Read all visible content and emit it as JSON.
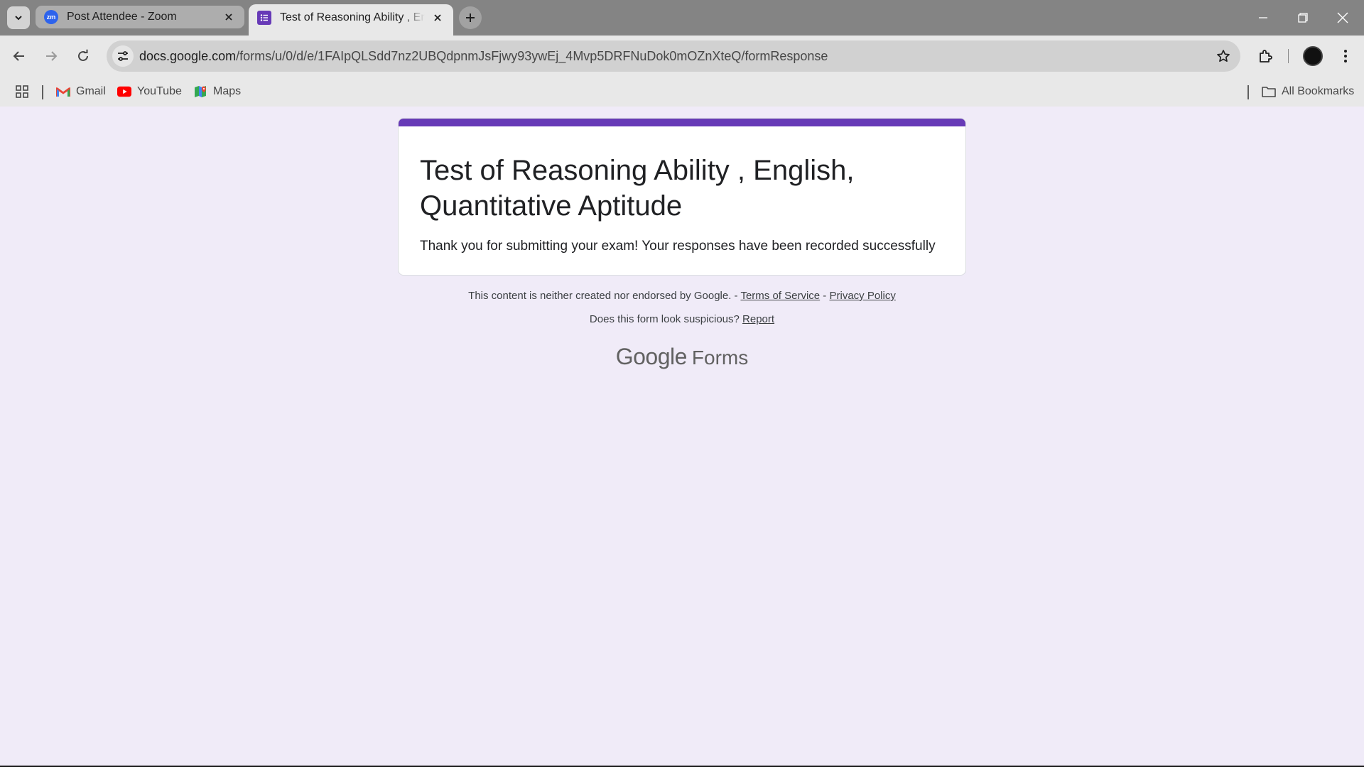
{
  "browser": {
    "tabs": [
      {
        "title": "Post Attendee - Zoom",
        "favicon_text": "zm",
        "active": false
      },
      {
        "title": "Test of Reasoning Ability , English, Quantitative Aptitude",
        "active": true
      }
    ],
    "url_host": "docs.google.com",
    "url_path": "/forms/u/0/d/e/1FAIpQLSdd7nz2UBQdpnmJsFjwy93ywEj_4Mvp5DRFNuDok0mOZnXteQ/formResponse",
    "bookmarks": [
      {
        "label": "Gmail",
        "icon": "gmail-icon"
      },
      {
        "label": "YouTube",
        "icon": "youtube-icon"
      },
      {
        "label": "Maps",
        "icon": "maps-icon"
      }
    ],
    "all_bookmarks_label": "All Bookmarks"
  },
  "form": {
    "title": "Test of Reasoning Ability , English, Quantitative Aptitude",
    "confirmation": "Thank you for submitting your exam! Your responses have been recorded successfully",
    "accent_color": "#673ab7"
  },
  "footer": {
    "disclaimer": "This content is neither created nor endorsed by Google.",
    "sep1": " - ",
    "terms_link": "Terms of Service",
    "sep2": " - ",
    "privacy_link": "Privacy Policy",
    "suspicious_text": "Does this form look suspicious?",
    "report_link": "Report",
    "brand_google": "Google",
    "brand_forms": "Forms"
  },
  "colors": {
    "page_bg": "#f0ebf8",
    "card_bar": "#673ab7"
  }
}
